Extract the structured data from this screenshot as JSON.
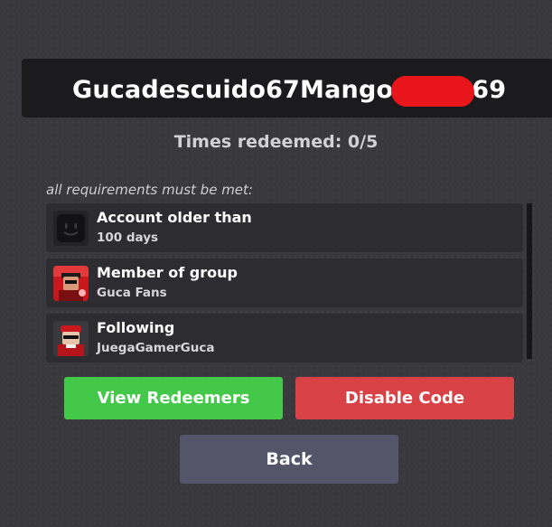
{
  "code": {
    "prefix": "Gucadescuido67Mango",
    "suffix": "69"
  },
  "times_redeemed": "Times redeemed: 0/5",
  "requirements": {
    "header": "all requirements must be met:",
    "items": [
      {
        "title": "Account older than",
        "sub": "100 days",
        "icon": "account-age-icon"
      },
      {
        "title": "Member of group",
        "sub": "Guca Fans",
        "icon": "group-thumbnail-icon"
      },
      {
        "title": "Following",
        "sub": "JuegaGamerGuca",
        "icon": "user-avatar-icon"
      }
    ]
  },
  "buttons": {
    "view_redeemers": "View Redeemers",
    "disable_code": "Disable Code",
    "back": "Back"
  },
  "colors": {
    "green": "#43c84a",
    "red": "#d84247",
    "back": "#55556a",
    "redaction": "#e8161b"
  }
}
